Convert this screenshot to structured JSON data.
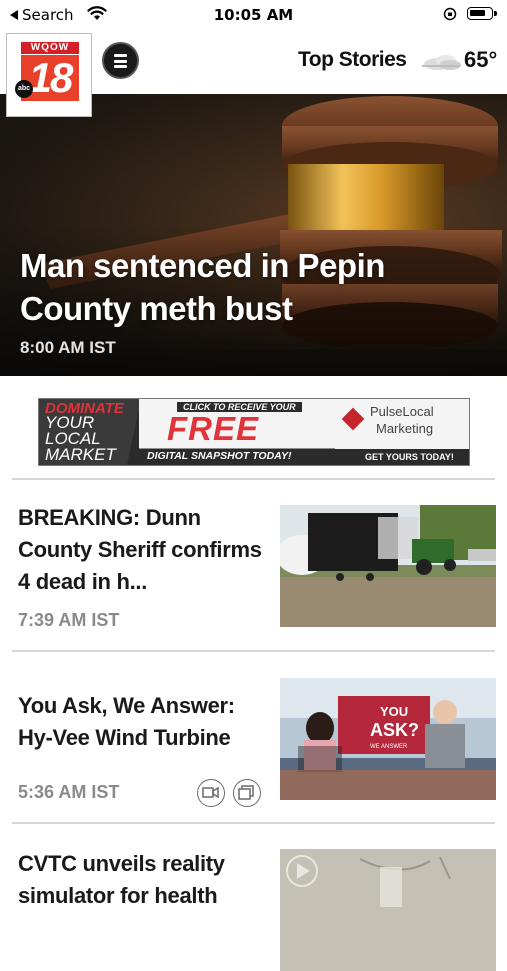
{
  "status_bar": {
    "back_label": "Search",
    "time": "10:05 AM"
  },
  "header": {
    "logo": {
      "top_text": "WQOW",
      "number": "18",
      "network": "abc"
    },
    "section_title": "Top Stories",
    "temperature": "65°",
    "weather_icon": "cloudy-icon"
  },
  "hero": {
    "headline": "Man sentenced in Pepin County meth bust",
    "time": "8:00 AM IST"
  },
  "ad": {
    "line1": "DOMINATE",
    "line2": "YOUR",
    "line3": "LOCAL",
    "line4": "MARKET",
    "click_text": "CLICK TO RECEIVE YOUR",
    "free_text": "FREE",
    "digital_text": "DIGITAL SNAPSHOT TODAY!",
    "brand_line1": "PulseLocal",
    "brand_line2": "Marketing",
    "cta": "GET YOURS TODAY!"
  },
  "stories": [
    {
      "title": "BREAKING: Dunn County Sheriff confirms 4 dead in h...",
      "time": "7:39 AM IST"
    },
    {
      "title": "You Ask, We Answer: Hy-Vee Wind Turbine",
      "time": "5:36 AM IST"
    },
    {
      "title": "CVTC unveils reality simulator for health",
      "time": ""
    }
  ],
  "thumb_text": {
    "you": "YOU",
    "ask": "ASK?",
    "we_answer": "WE ANSWER"
  }
}
